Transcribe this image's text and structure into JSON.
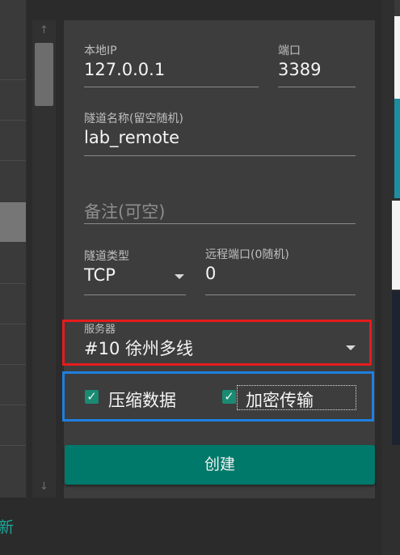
{
  "form": {
    "local_ip": {
      "label": "本地IP",
      "value": "127.0.0.1"
    },
    "port": {
      "label": "端口",
      "value": "3389"
    },
    "tunnel_name": {
      "label": "隧道名称(留空随机)",
      "value": "lab_remote"
    },
    "remark": {
      "placeholder": "备注(可空)"
    },
    "tunnel_type": {
      "label": "隧道类型",
      "value": "TCP"
    },
    "remote_port": {
      "label": "远程端口(0随机)",
      "value": "0"
    },
    "server": {
      "label": "服务器",
      "value": "#10 徐州多线"
    },
    "compress": {
      "label": "压缩数据",
      "checked": true
    },
    "encrypt": {
      "label": "加密传输",
      "checked": true
    },
    "create_button": "创建"
  },
  "background": {
    "left_bottom_text": "新"
  },
  "colors": {
    "accent": "#00796b",
    "highlight_red": "#e51c1c",
    "highlight_blue": "#1f7fe0"
  }
}
